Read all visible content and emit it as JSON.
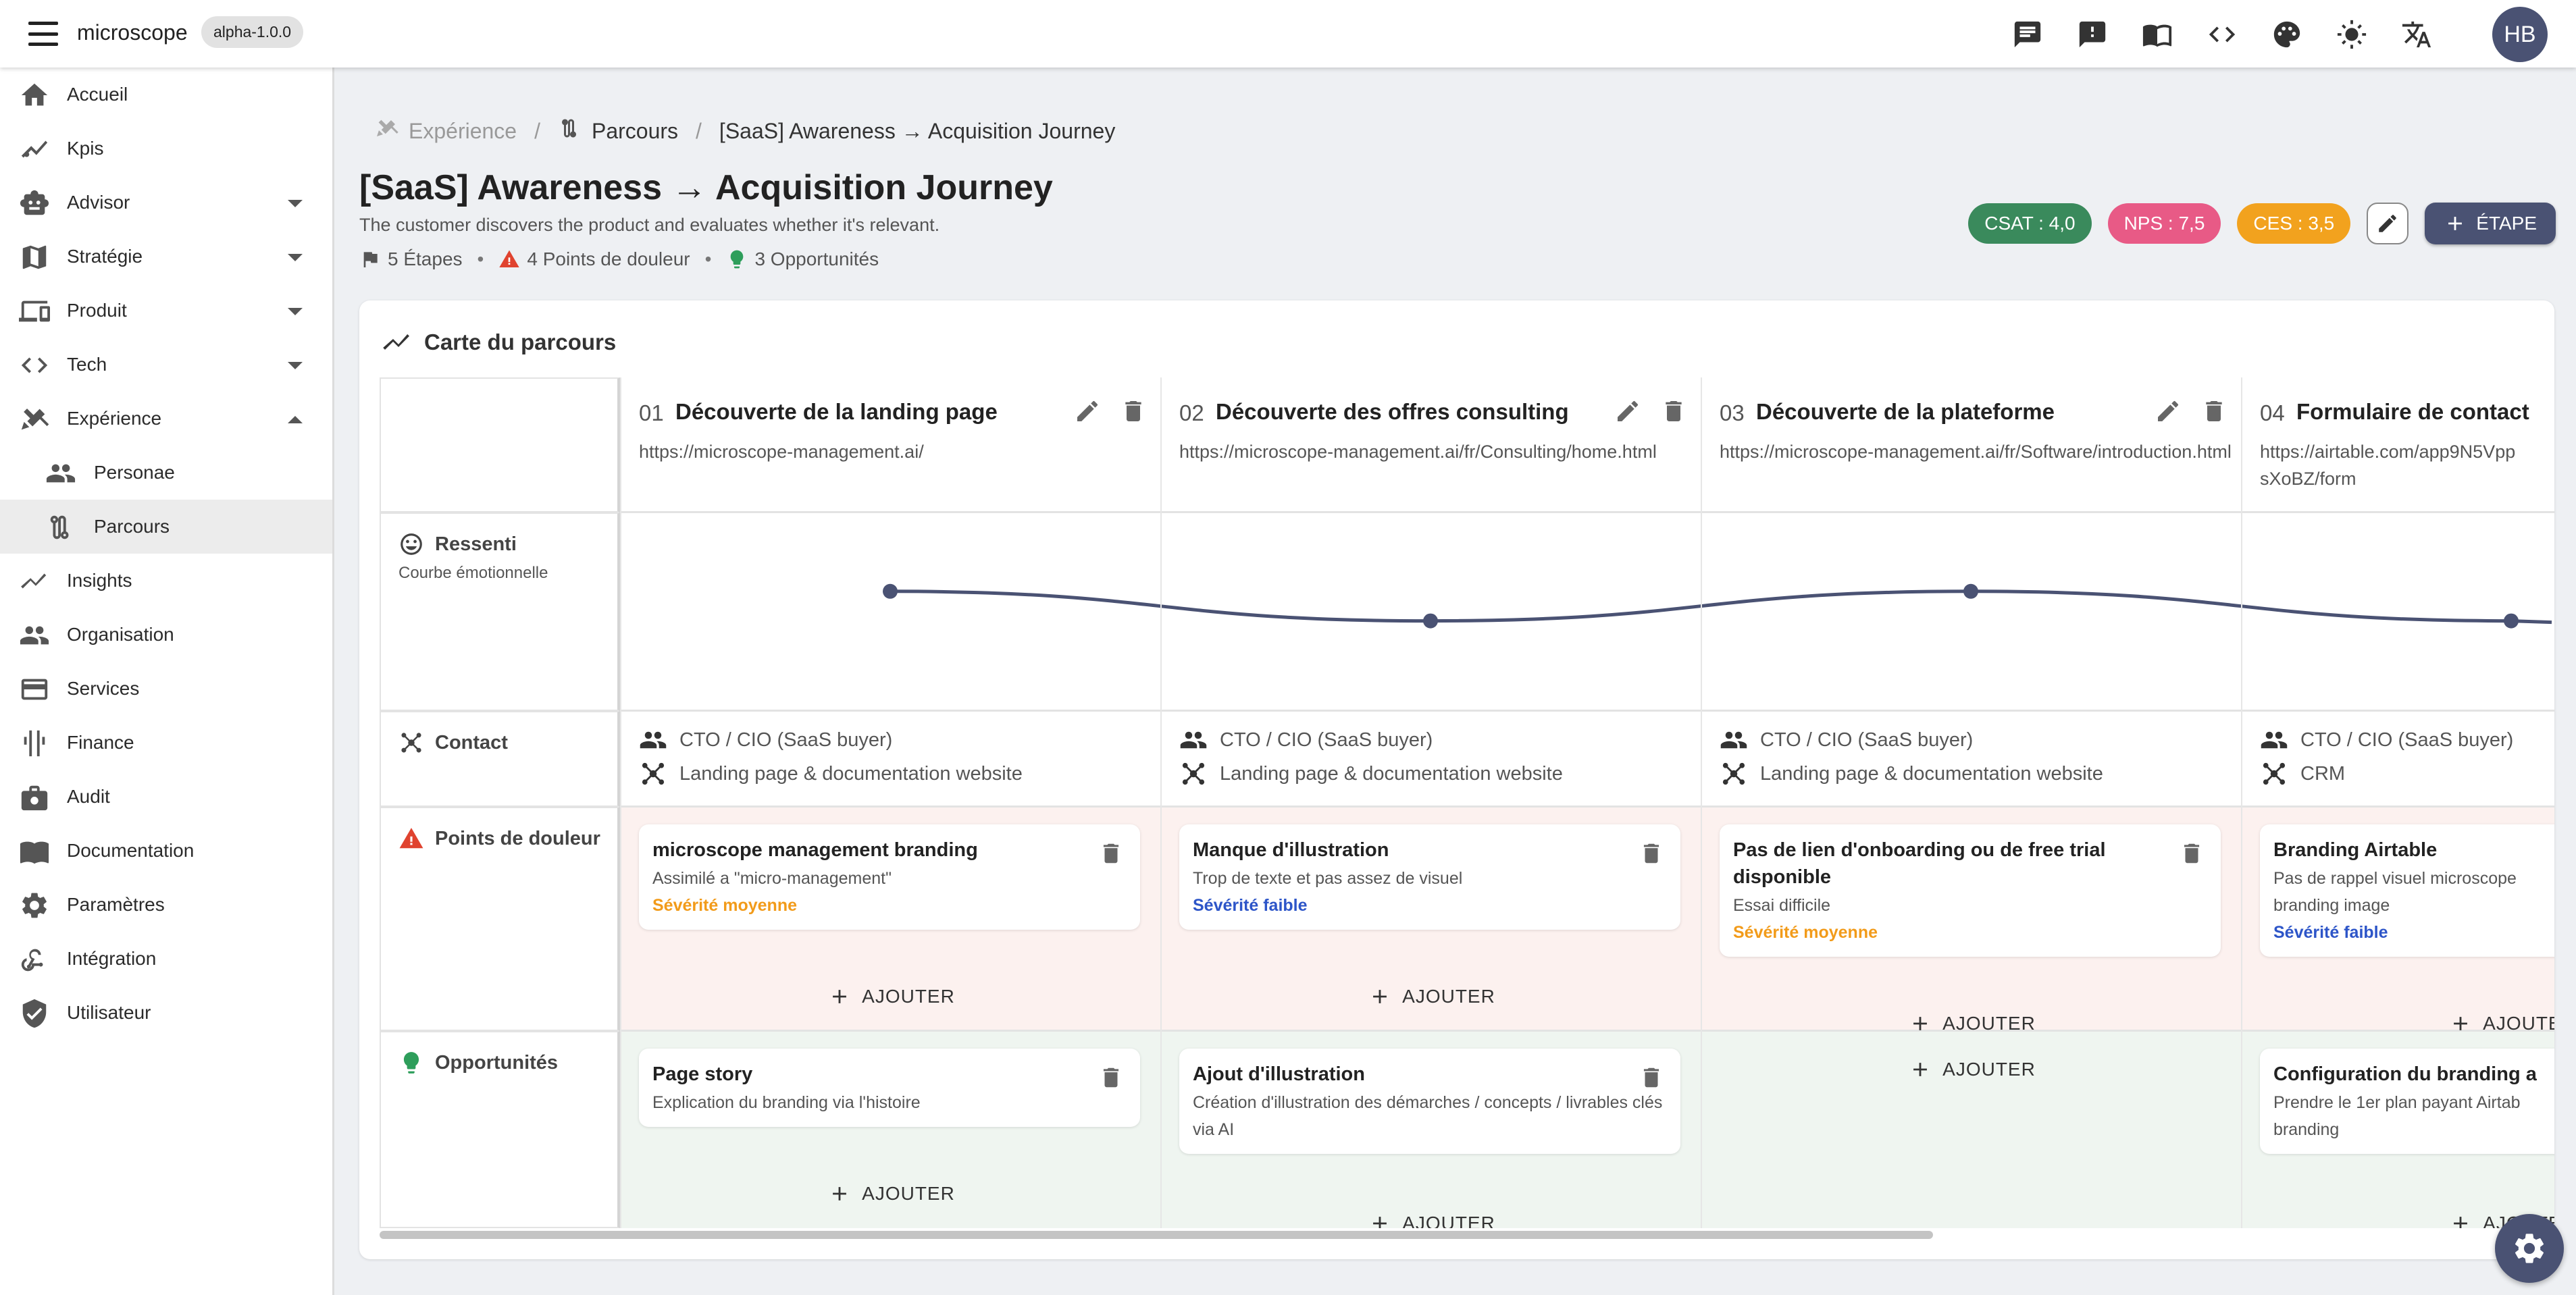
{
  "app": {
    "name": "microscope",
    "version": "alpha-1.0.0",
    "avatar": "HB"
  },
  "topbar_icons": [
    "chat-icon",
    "feedback-icon",
    "docs-book-icon",
    "code-icon",
    "palette-icon",
    "brightness-icon",
    "translate-icon"
  ],
  "sidebar": {
    "items": [
      {
        "label": "Accueil",
        "icon": "home-icon"
      },
      {
        "label": "Kpis",
        "icon": "kpi-chart-icon"
      },
      {
        "label": "Advisor",
        "icon": "robot-icon"
      },
      {
        "label": "Stratégie",
        "icon": "map-icon"
      },
      {
        "label": "Produit",
        "icon": "devices-icon"
      },
      {
        "label": "Tech",
        "icon": "code-icon"
      },
      {
        "label": "Expérience",
        "icon": "design-tools-icon"
      },
      {
        "label": "Personae",
        "icon": "people-icon"
      },
      {
        "label": "Parcours",
        "icon": "route-icon"
      },
      {
        "label": "Insights",
        "icon": "insights-icon"
      },
      {
        "label": "Organisation",
        "icon": "groups-icon"
      },
      {
        "label": "Services",
        "icon": "card-icon"
      },
      {
        "label": "Finance",
        "icon": "scale-icon"
      },
      {
        "label": "Audit",
        "icon": "briefcase-icon"
      },
      {
        "label": "Documentation",
        "icon": "book-icon"
      },
      {
        "label": "Paramètres",
        "icon": "gear-icon"
      },
      {
        "label": "Intégration",
        "icon": "webhook-icon"
      },
      {
        "label": "Utilisateur",
        "icon": "shield-icon"
      }
    ]
  },
  "breadcrumb": {
    "item1": "Expérience",
    "item2": "Parcours",
    "current": "[SaaS] Awareness → Acquisition Journey"
  },
  "journey": {
    "title": "[SaaS] Awareness → Acquisition Journey",
    "subtitle": "The customer discovers the product and evaluates whether it's relevant.",
    "steps_count": "5 Étapes",
    "pains_count": "4 Points de douleur",
    "opps_count": "3 Opportunités"
  },
  "scores": {
    "csat": "CSAT : 4,0",
    "nps": "NPS : 7,5",
    "ces": "CES : 3,5"
  },
  "add_step_label": "ÉTAPE",
  "map": {
    "title": "Carte du parcours",
    "row_labels": {
      "ressenti": "Ressenti",
      "ressenti_sub": "Courbe émotionnelle",
      "contact": "Contact",
      "pains": "Points de douleur",
      "opps": "Opportunités"
    },
    "add_label": "AJOUTER",
    "stages": [
      {
        "num": "01",
        "title": "Découverte de la landing page",
        "url": "https://microscope-management.ai/",
        "persona": "CTO / CIO (SaaS buyer)",
        "channel": "Landing page & documentation website",
        "pain": {
          "title": "microscope management branding",
          "desc": "Assimilé a \"micro-management\"",
          "severity": "Sévérité moyenne"
        },
        "opp": {
          "title": "Page story",
          "desc": "Explication du branding via l'histoire"
        }
      },
      {
        "num": "02",
        "title": "Découverte des offres consulting",
        "url": "https://microscope-management.ai/fr/Consulting/home.html",
        "persona": "CTO / CIO (SaaS buyer)",
        "channel": "Landing page & documentation website",
        "pain": {
          "title": "Manque d'illustration",
          "desc": "Trop de texte et pas assez de visuel",
          "severity": "Sévérité faible"
        },
        "opp": {
          "title": "Ajout d'illustration",
          "desc": "Création d'illustration des démarches / concepts / livrables clés via AI"
        }
      },
      {
        "num": "03",
        "title": "Découverte de la plateforme",
        "url": "https://microscope-management.ai/fr/Software/introduction.html",
        "persona": "CTO / CIO (SaaS buyer)",
        "channel": "Landing page & documentation website",
        "pain": {
          "title": "Pas de lien d'onboarding ou de free trial disponible",
          "desc": "Essai difficile",
          "severity": "Sévérité moyenne"
        }
      },
      {
        "num": "04",
        "title": "Formulaire de contact",
        "url": "https://airtable.com/app9N5Vpp sXoBZ/form",
        "persona": "CTO / CIO (SaaS buyer)",
        "channel": "CRM",
        "pain": {
          "title": "Branding Airtable",
          "desc": "Pas de rappel visuel microscope branding image",
          "severity": "Sévérité faible"
        },
        "opp": {
          "title": "Configuration du branding a",
          "desc": "Prendre le 1er plan payant Airtab branding"
        }
      }
    ],
    "emotion_curve": [
      0.6,
      0.45,
      0.6,
      0.45
    ],
    "colors": {
      "csat": "#3a8a5c",
      "nps": "#e85a86",
      "ces": "#f2a21e",
      "primary": "#4a5273",
      "pain_bg": "#fcf1ef",
      "opp_bg": "#eff5f0",
      "sev_medium": "#f29b1a",
      "sev_low": "#2d55c8",
      "warn": "#e0432f",
      "bulb": "#2e9e5b"
    }
  }
}
